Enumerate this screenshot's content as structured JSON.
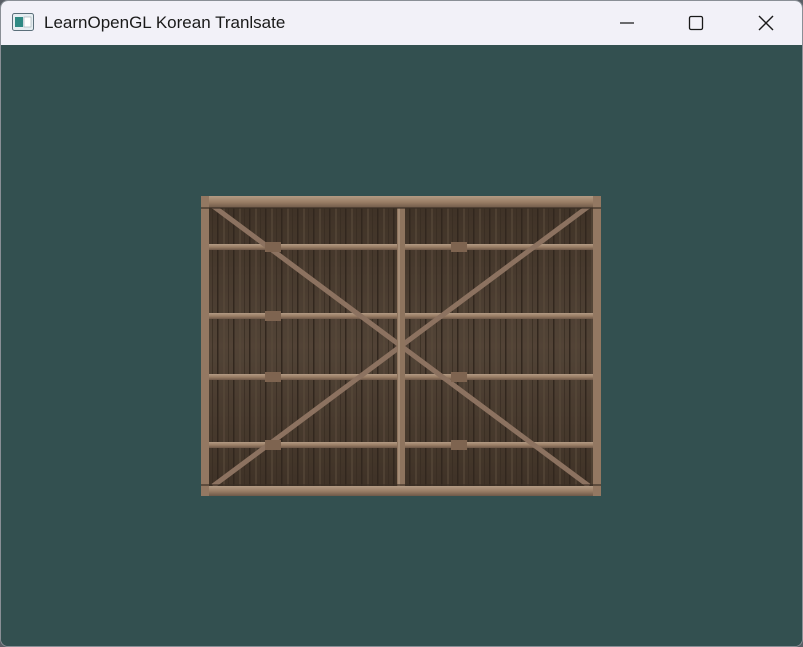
{
  "window": {
    "title": "LearnOpenGL Korean Tranlsate",
    "icon": "app-window-icon",
    "controls": {
      "minimize": "minimize-icon",
      "maximize": "maximize-icon",
      "close": "close-icon"
    }
  },
  "viewport": {
    "clear_color": "#335050",
    "textured_quad": {
      "texture": "wooden-container",
      "plank_color": "#4a3a2c",
      "beam_color": "#9a7e66"
    }
  }
}
